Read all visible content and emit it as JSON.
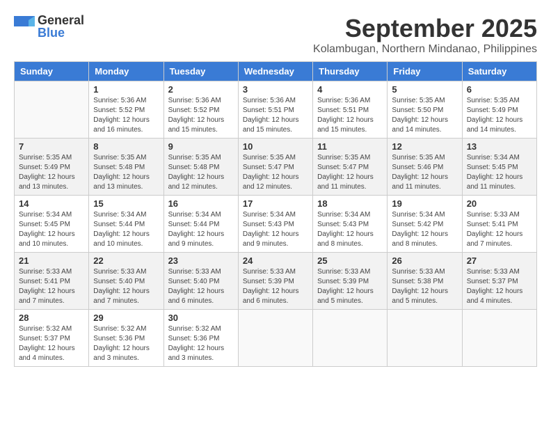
{
  "logo": {
    "general": "General",
    "blue": "Blue"
  },
  "title": "September 2025",
  "subtitle": "Kolambugan, Northern Mindanao, Philippines",
  "headers": [
    "Sunday",
    "Monday",
    "Tuesday",
    "Wednesday",
    "Thursday",
    "Friday",
    "Saturday"
  ],
  "weeks": [
    [
      {
        "day": "",
        "info": ""
      },
      {
        "day": "1",
        "info": "Sunrise: 5:36 AM\nSunset: 5:52 PM\nDaylight: 12 hours\nand 16 minutes."
      },
      {
        "day": "2",
        "info": "Sunrise: 5:36 AM\nSunset: 5:52 PM\nDaylight: 12 hours\nand 15 minutes."
      },
      {
        "day": "3",
        "info": "Sunrise: 5:36 AM\nSunset: 5:51 PM\nDaylight: 12 hours\nand 15 minutes."
      },
      {
        "day": "4",
        "info": "Sunrise: 5:36 AM\nSunset: 5:51 PM\nDaylight: 12 hours\nand 15 minutes."
      },
      {
        "day": "5",
        "info": "Sunrise: 5:35 AM\nSunset: 5:50 PM\nDaylight: 12 hours\nand 14 minutes."
      },
      {
        "day": "6",
        "info": "Sunrise: 5:35 AM\nSunset: 5:49 PM\nDaylight: 12 hours\nand 14 minutes."
      }
    ],
    [
      {
        "day": "7",
        "info": "Sunrise: 5:35 AM\nSunset: 5:49 PM\nDaylight: 12 hours\nand 13 minutes."
      },
      {
        "day": "8",
        "info": "Sunrise: 5:35 AM\nSunset: 5:48 PM\nDaylight: 12 hours\nand 13 minutes."
      },
      {
        "day": "9",
        "info": "Sunrise: 5:35 AM\nSunset: 5:48 PM\nDaylight: 12 hours\nand 12 minutes."
      },
      {
        "day": "10",
        "info": "Sunrise: 5:35 AM\nSunset: 5:47 PM\nDaylight: 12 hours\nand 12 minutes."
      },
      {
        "day": "11",
        "info": "Sunrise: 5:35 AM\nSunset: 5:47 PM\nDaylight: 12 hours\nand 11 minutes."
      },
      {
        "day": "12",
        "info": "Sunrise: 5:35 AM\nSunset: 5:46 PM\nDaylight: 12 hours\nand 11 minutes."
      },
      {
        "day": "13",
        "info": "Sunrise: 5:34 AM\nSunset: 5:45 PM\nDaylight: 12 hours\nand 11 minutes."
      }
    ],
    [
      {
        "day": "14",
        "info": "Sunrise: 5:34 AM\nSunset: 5:45 PM\nDaylight: 12 hours\nand 10 minutes."
      },
      {
        "day": "15",
        "info": "Sunrise: 5:34 AM\nSunset: 5:44 PM\nDaylight: 12 hours\nand 10 minutes."
      },
      {
        "day": "16",
        "info": "Sunrise: 5:34 AM\nSunset: 5:44 PM\nDaylight: 12 hours\nand 9 minutes."
      },
      {
        "day": "17",
        "info": "Sunrise: 5:34 AM\nSunset: 5:43 PM\nDaylight: 12 hours\nand 9 minutes."
      },
      {
        "day": "18",
        "info": "Sunrise: 5:34 AM\nSunset: 5:43 PM\nDaylight: 12 hours\nand 8 minutes."
      },
      {
        "day": "19",
        "info": "Sunrise: 5:34 AM\nSunset: 5:42 PM\nDaylight: 12 hours\nand 8 minutes."
      },
      {
        "day": "20",
        "info": "Sunrise: 5:33 AM\nSunset: 5:41 PM\nDaylight: 12 hours\nand 7 minutes."
      }
    ],
    [
      {
        "day": "21",
        "info": "Sunrise: 5:33 AM\nSunset: 5:41 PM\nDaylight: 12 hours\nand 7 minutes."
      },
      {
        "day": "22",
        "info": "Sunrise: 5:33 AM\nSunset: 5:40 PM\nDaylight: 12 hours\nand 7 minutes."
      },
      {
        "day": "23",
        "info": "Sunrise: 5:33 AM\nSunset: 5:40 PM\nDaylight: 12 hours\nand 6 minutes."
      },
      {
        "day": "24",
        "info": "Sunrise: 5:33 AM\nSunset: 5:39 PM\nDaylight: 12 hours\nand 6 minutes."
      },
      {
        "day": "25",
        "info": "Sunrise: 5:33 AM\nSunset: 5:39 PM\nDaylight: 12 hours\nand 5 minutes."
      },
      {
        "day": "26",
        "info": "Sunrise: 5:33 AM\nSunset: 5:38 PM\nDaylight: 12 hours\nand 5 minutes."
      },
      {
        "day": "27",
        "info": "Sunrise: 5:33 AM\nSunset: 5:37 PM\nDaylight: 12 hours\nand 4 minutes."
      }
    ],
    [
      {
        "day": "28",
        "info": "Sunrise: 5:32 AM\nSunset: 5:37 PM\nDaylight: 12 hours\nand 4 minutes."
      },
      {
        "day": "29",
        "info": "Sunrise: 5:32 AM\nSunset: 5:36 PM\nDaylight: 12 hours\nand 3 minutes."
      },
      {
        "day": "30",
        "info": "Sunrise: 5:32 AM\nSunset: 5:36 PM\nDaylight: 12 hours\nand 3 minutes."
      },
      {
        "day": "",
        "info": ""
      },
      {
        "day": "",
        "info": ""
      },
      {
        "day": "",
        "info": ""
      },
      {
        "day": "",
        "info": ""
      }
    ]
  ]
}
